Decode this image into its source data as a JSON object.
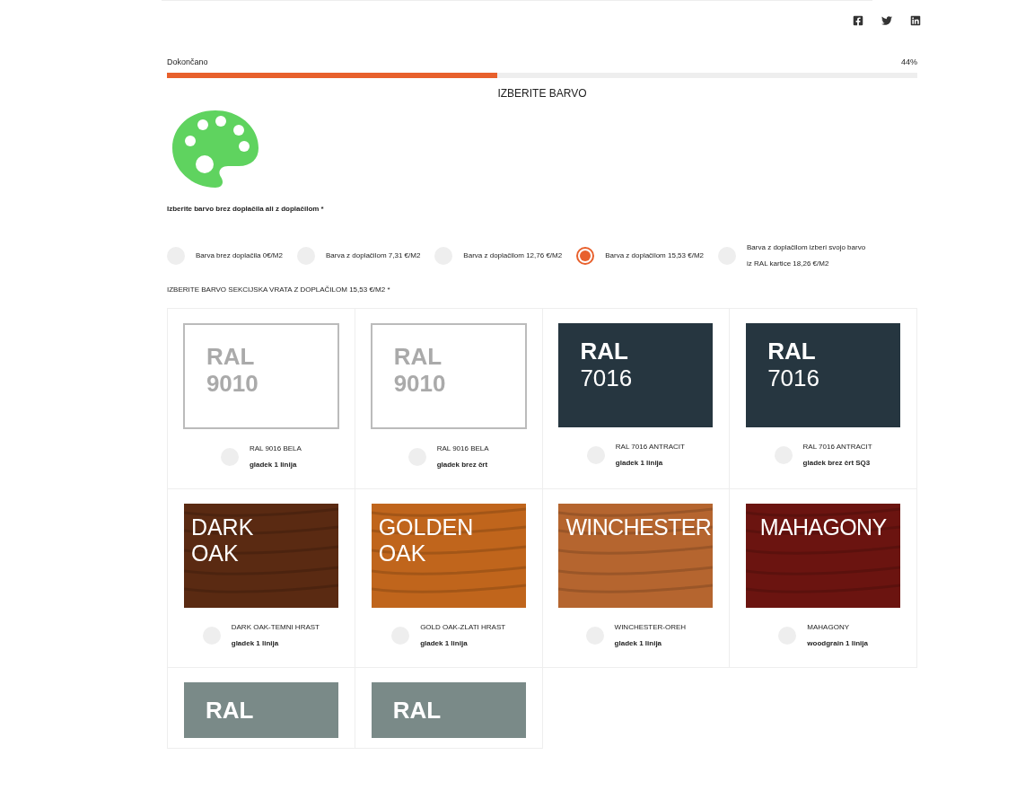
{
  "progress": {
    "label": "Dokončano",
    "reading": "44%",
    "level": 0.44
  },
  "step_title": "IZBERITE BARVO",
  "question": "Izberite barvo brez doplačila ali z doplačilom *",
  "options": [
    {
      "label": "Barva brez doplačila 0€/M2",
      "selected": false
    },
    {
      "label": "Barva z doplačilom 7,31 €/M2",
      "selected": false
    },
    {
      "label": "Barva z doplačilom 12,76 €/M2",
      "selected": false
    },
    {
      "label": "Barva z doplačilom 15,53 €/M2",
      "selected": true
    },
    {
      "label": "Barva z doplačilom izberi svojo barvo iz RAL kartice 18,26 €/M2",
      "selected": false
    }
  ],
  "section_title": "IZBERITE BARVO SEKCIJSKA VRATA Z DOPLAČILOM 15,53 €/M2 *",
  "colors": [
    {
      "kind": "light",
      "swatch": [
        "RAL",
        "9010"
      ],
      "name": "RAL 9016 BELA",
      "finish": "gladek 1 linija",
      "selected": false
    },
    {
      "kind": "light",
      "swatch": [
        "RAL",
        "9010"
      ],
      "name": "RAL 9016 BELA",
      "finish": "gladek brez črt",
      "selected": false
    },
    {
      "kind": "dark",
      "color": "#263640",
      "swatch": [
        "RAL",
        "7016"
      ],
      "name": "RAL 7016 ANTRACIT",
      "finish": "gladek 1 linija",
      "selected": false
    },
    {
      "kind": "dark",
      "color": "#263640",
      "swatch": [
        "RAL",
        "7016"
      ],
      "name": "RAL 7016 ANTRACIT",
      "finish": "gladek brez črt SQ3",
      "selected": false
    },
    {
      "kind": "wood",
      "color": "#5a2a12",
      "swatch": [
        "DARK",
        "OAK"
      ],
      "name": "DARK OAK-TEMNI HRAST",
      "finish": "gladek 1 linija",
      "selected": false
    },
    {
      "kind": "wood",
      "color": "#c0651c",
      "swatch": [
        "GOLDEN",
        "OAK"
      ],
      "name": "GOLD OAK-ZLATI HRAST",
      "finish": "gladek 1 linija",
      "selected": false
    },
    {
      "kind": "wood",
      "color": "#b5652f",
      "swatch": [
        "WINCHESTER"
      ],
      "name": "WINCHESTER-OREH",
      "finish": "gladek 1 linija",
      "selected": false
    },
    {
      "kind": "wood",
      "color": "#6b1410",
      "swatch": [
        "MAHAGONY"
      ],
      "name": "MAHAGONY",
      "finish": "woodgrain 1 linija",
      "selected": false
    },
    {
      "kind": "dark",
      "color": "#7a8a88",
      "swatch": [
        "RAL"
      ]
    },
    {
      "kind": "dark",
      "color": "#7a8a88",
      "swatch": [
        "RAL"
      ]
    }
  ]
}
